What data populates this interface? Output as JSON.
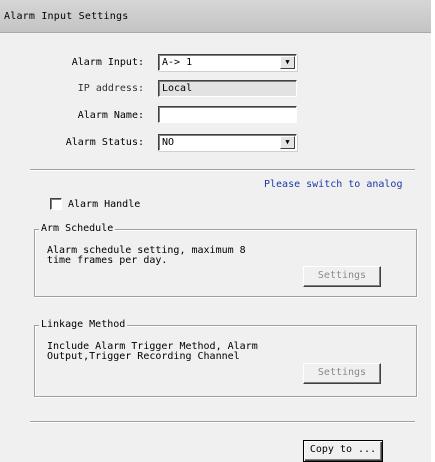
{
  "window": {
    "title": "Alarm Input Settings"
  },
  "form": {
    "alarm_input": {
      "label": "Alarm Input:",
      "value": "A-> 1"
    },
    "ip_address": {
      "label": "IP address:",
      "value": "Local"
    },
    "alarm_name": {
      "label": "Alarm Name:",
      "value": ""
    },
    "alarm_status": {
      "label": "Alarm Status:",
      "value": "NO"
    }
  },
  "notice": "Please switch to analog",
  "alarm_handle": {
    "label": "Alarm Handle",
    "checked": false
  },
  "arm_schedule": {
    "title": "Arm Schedule",
    "description": "Alarm schedule setting, maximum 8\ntime frames per day.",
    "button": "Settings"
  },
  "linkage_method": {
    "title": "Linkage Method",
    "description": "Include Alarm Trigger Method, Alarm\nOutput,Trigger Recording Channel",
    "button": "Settings"
  },
  "copy_button": "Copy to ...",
  "icons": {
    "dropdown": "chevron-down-icon",
    "checkbox": "checkbox-unchecked-icon"
  }
}
